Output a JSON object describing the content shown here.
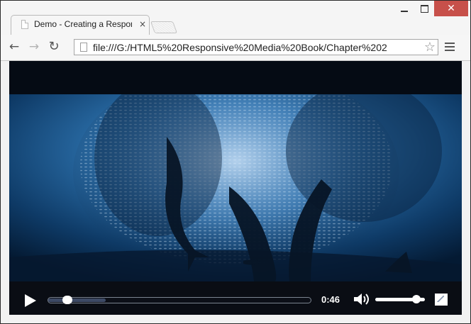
{
  "window": {
    "controls": {
      "minimize": "",
      "maximize": "",
      "close": "✕"
    }
  },
  "tab": {
    "title": "Demo - Creating a Respon",
    "close_label": "×",
    "icon": "document-icon"
  },
  "toolbar": {
    "back_label": "←",
    "forward_label": "→",
    "reload_label": "↻",
    "url": "file:///G:/HTML5%20Responsive%20Media%20Book/Chapter%202",
    "star_label": "☆",
    "icons": [
      "back-arrow-icon",
      "forward-arrow-icon",
      "reload-icon",
      "page-icon",
      "star-icon",
      "menu-icon"
    ]
  },
  "video": {
    "time": "0:46",
    "progress_fraction": 0.06,
    "buffered_fraction": 0.22,
    "volume_fraction": 0.9,
    "colors": {
      "letterbox": "#050b14",
      "water": "#1d5d95",
      "controls_bg": "#0a0d14"
    }
  }
}
